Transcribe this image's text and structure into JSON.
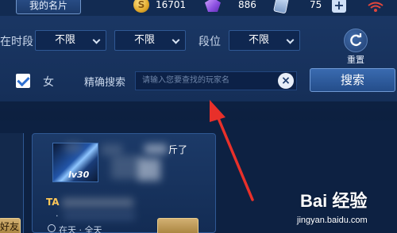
{
  "topbar": {
    "my_card_label": "我的名片",
    "gold": "16701",
    "gems": "886",
    "tickets": "75",
    "add_label": "+"
  },
  "filters": {
    "time_label": "在时段",
    "time_value": "不限",
    "time_value2": "不限",
    "rank_label": "段位",
    "rank_value": "不限",
    "reset_label": "重置"
  },
  "search": {
    "female_label": "女",
    "precise_label": "精确搜索",
    "placeholder": "请输入您要查找的玩家名",
    "clear_icon": "×",
    "button_label": "搜索"
  },
  "card": {
    "level": "lv30",
    "status": "斤了",
    "title_prefix": "TA",
    "online_text": "在天 · 全天",
    "dot": "·"
  },
  "left_card": {
    "friend_label": "好友"
  },
  "watermark": {
    "logo": "Bai 经验",
    "url": "jingyan.baidu.com"
  }
}
